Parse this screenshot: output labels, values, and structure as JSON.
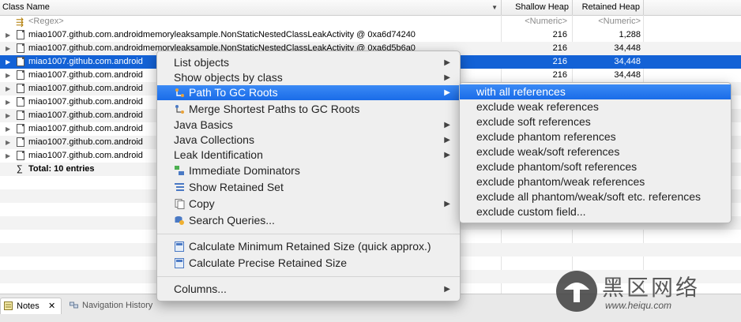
{
  "table": {
    "headers": {
      "class_name": "Class Name",
      "shallow": "Shallow Heap",
      "retained": "Retained Heap"
    },
    "regex_row": {
      "name": "<Regex>",
      "shallow": "<Numeric>",
      "retained": "<Numeric>"
    },
    "rows": [
      {
        "name": "miao1007.github.com.androidmemoryleaksample.NonStaticNestedClassLeakActivity @ 0xa6d74240",
        "shallow": "216",
        "retained": "1,288"
      },
      {
        "name": "miao1007.github.com.androidmemoryleaksample.NonStaticNestedClassLeakActivity @ 0xa6d5b6a0",
        "shallow": "216",
        "retained": "34,448"
      },
      {
        "name": "miao1007.github.com.android",
        "shallow": "216",
        "retained": "34,448"
      },
      {
        "name": "miao1007.github.com.android",
        "shallow": "216",
        "retained": "34,448"
      },
      {
        "name": "miao1007.github.com.android",
        "shallow": "",
        "retained": ""
      },
      {
        "name": "miao1007.github.com.android",
        "shallow": "",
        "retained": ""
      },
      {
        "name": "miao1007.github.com.android",
        "shallow": "",
        "retained": ""
      },
      {
        "name": "miao1007.github.com.android",
        "shallow": "",
        "retained": ""
      },
      {
        "name": "miao1007.github.com.android",
        "shallow": "",
        "retained": ""
      },
      {
        "name": "miao1007.github.com.android",
        "shallow": "",
        "retained": ""
      }
    ],
    "total": "Total: 10 entries"
  },
  "context_menu": {
    "items": [
      {
        "label": "List objects"
      },
      {
        "label": "Show objects by class"
      },
      {
        "label": "Path To GC Roots"
      },
      {
        "label": "Merge Shortest Paths to GC Roots"
      },
      {
        "label": "Java Basics"
      },
      {
        "label": "Java Collections"
      },
      {
        "label": "Leak Identification"
      },
      {
        "label": "Immediate Dominators"
      },
      {
        "label": "Show Retained Set"
      },
      {
        "label": "Copy"
      },
      {
        "label": "Search Queries..."
      },
      {
        "label": "Calculate Minimum Retained Size (quick approx.)"
      },
      {
        "label": "Calculate Precise Retained Size"
      },
      {
        "label": "Columns..."
      }
    ]
  },
  "submenu": {
    "items": [
      {
        "label": "with all references"
      },
      {
        "label": "exclude weak references"
      },
      {
        "label": "exclude soft references"
      },
      {
        "label": "exclude phantom references"
      },
      {
        "label": "exclude weak/soft references"
      },
      {
        "label": "exclude phantom/soft references"
      },
      {
        "label": "exclude phantom/weak references"
      },
      {
        "label": "exclude all phantom/weak/soft etc. references"
      },
      {
        "label": "exclude custom field..."
      }
    ]
  },
  "bottom_tabs": {
    "notes": "Notes",
    "nav_history": "Navigation History"
  },
  "watermark": {
    "title": "黑区网络",
    "url": "www.heiqu.com"
  },
  "colors": {
    "selection": "#1362d6",
    "menu_highlight": "#1a6ce8"
  }
}
